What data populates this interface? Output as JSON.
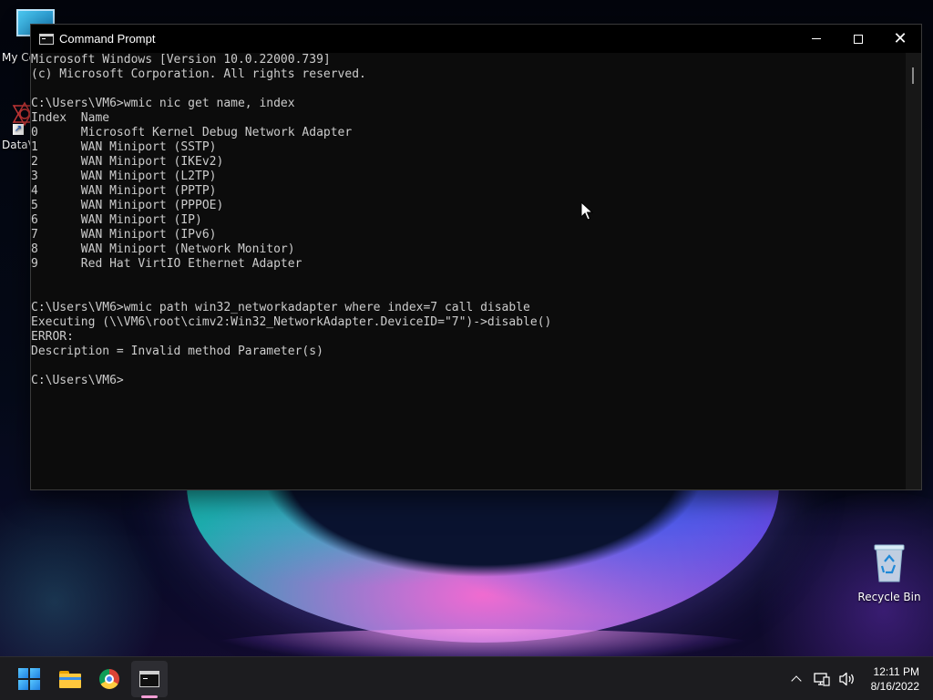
{
  "desktop": {
    "icons": {
      "my_computer": "My Co",
      "data_shortcut": "DataV",
      "recycle_bin": "Recycle Bin"
    }
  },
  "window": {
    "title": "Command Prompt",
    "icon": "cmd-icon",
    "controls": {
      "minimize": "minimize-icon",
      "maximize": "maximize-icon",
      "close": "close-icon"
    }
  },
  "console": {
    "lines": [
      "Microsoft Windows [Version 10.0.22000.739]",
      "(c) Microsoft Corporation. All rights reserved.",
      "",
      "C:\\Users\\VM6>wmic nic get name, index",
      "Index  Name",
      "0      Microsoft Kernel Debug Network Adapter",
      "1      WAN Miniport (SSTP)",
      "2      WAN Miniport (IKEv2)",
      "3      WAN Miniport (L2TP)",
      "4      WAN Miniport (PPTP)",
      "5      WAN Miniport (PPPOE)",
      "6      WAN Miniport (IP)",
      "7      WAN Miniport (IPv6)",
      "8      WAN Miniport (Network Monitor)",
      "9      Red Hat VirtIO Ethernet Adapter",
      "",
      "",
      "C:\\Users\\VM6>wmic path win32_networkadapter where index=7 call disable",
      "Executing (\\\\VM6\\root\\cimv2:Win32_NetworkAdapter.DeviceID=\"7\")->disable()",
      "ERROR:",
      "Description = Invalid method Parameter(s)",
      "",
      "C:\\Users\\VM6>"
    ]
  },
  "taskbar": {
    "apps": [
      {
        "name": "start",
        "icon": "windows-start-icon"
      },
      {
        "name": "file-explorer",
        "icon": "folder-icon"
      },
      {
        "name": "chrome",
        "icon": "chrome-icon"
      },
      {
        "name": "command-prompt",
        "icon": "cmd-icon",
        "active": true
      }
    ],
    "tray": {
      "icons": [
        "chevron-up-icon",
        "network-icon",
        "volume-icon"
      ],
      "time": "12:11 PM",
      "date": "8/16/2022"
    }
  },
  "colors": {
    "console_bg": "#0c0c0c",
    "console_text": "#cccccc",
    "taskbar_bg": "#1c1c1f",
    "active_indicator": "#f39ed6"
  }
}
